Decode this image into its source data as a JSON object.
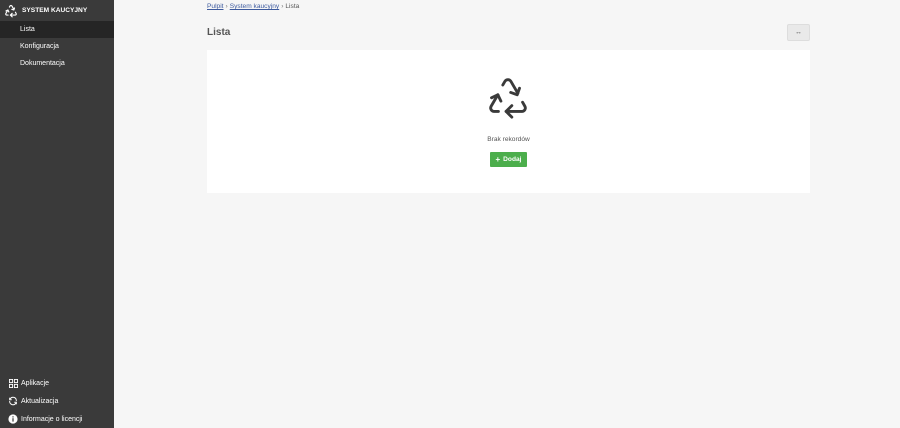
{
  "app": {
    "title": "SYSTEM KAUCYJNY"
  },
  "sidebar": {
    "items": [
      {
        "label": "Lista",
        "active": true
      },
      {
        "label": "Konfiguracja",
        "active": false
      },
      {
        "label": "Dokumentacja",
        "active": false
      }
    ],
    "bottom": [
      {
        "label": "Aplikacje",
        "icon": "grid-icon"
      },
      {
        "label": "Aktualizacja",
        "icon": "refresh-icon"
      },
      {
        "label": "Informacje o licencji",
        "icon": "info-icon"
      }
    ]
  },
  "breadcrumb": {
    "home": "Pulpit",
    "module": "System kaucyjny",
    "current": "Lista",
    "separator": "›"
  },
  "header": {
    "title": "Lista",
    "expand_label": "↔",
    "expand_icon": "expand-icon"
  },
  "empty_state": {
    "icon": "recycle-icon",
    "message": "Brak rekordów",
    "add_label": "Dodaj",
    "add_icon": "plus-icon"
  },
  "colors": {
    "sidebar": "#3a3a3a",
    "sidebar_active": "#252525",
    "primary_button": "#4cae4c",
    "link": "#3d5a9e",
    "page_bg": "#f6f6f6"
  }
}
